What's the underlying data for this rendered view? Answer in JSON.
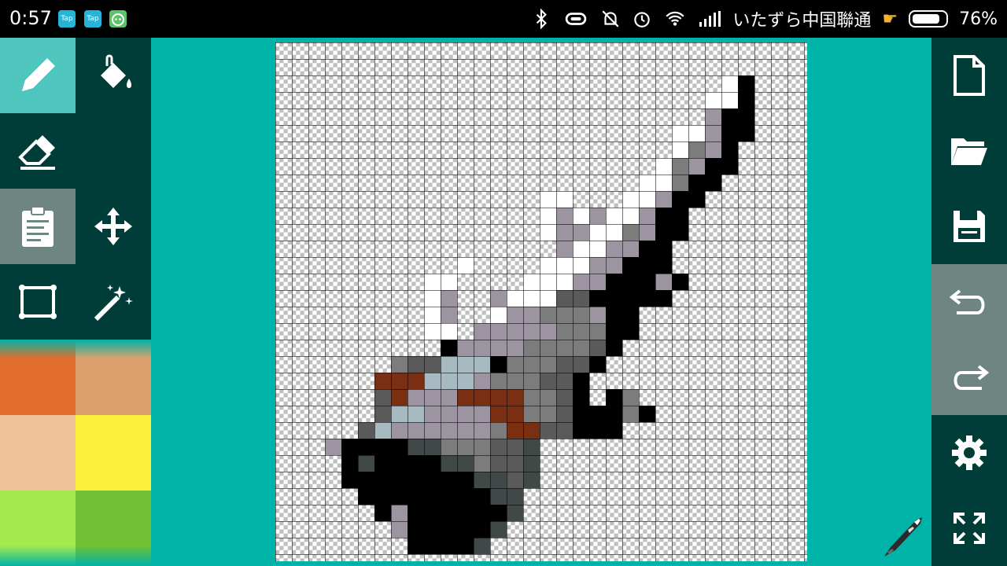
{
  "status_bar": {
    "time": "0:57",
    "app_icons": [
      {
        "name": "tap-app-icon",
        "label": "Tap",
        "color": "#28b4d6"
      },
      {
        "name": "tap-app-icon-2",
        "label": "Tap",
        "color": "#28b4d6"
      },
      {
        "name": "android-cat-icon",
        "label": "",
        "color": "#5cc36a"
      }
    ],
    "carrier": "いたずら中国聯通",
    "battery": "76%"
  },
  "tools": [
    {
      "name": "pencil-tool",
      "icon": "pencil-icon",
      "selected": true
    },
    {
      "name": "fill-tool",
      "icon": "paint-bucket-icon",
      "selected": false
    },
    {
      "name": "eraser-tool",
      "icon": "eraser-icon",
      "selected": false
    },
    {
      "name": "clipboard-tool",
      "icon": "clipboard-icon",
      "selected": true
    },
    {
      "name": "move-tool",
      "icon": "move-arrows-icon",
      "selected": false
    },
    {
      "name": "rectangle-select-tool",
      "icon": "rectangle-icon",
      "selected": false
    },
    {
      "name": "magic-wand-tool",
      "icon": "magic-wand-icon",
      "selected": false
    }
  ],
  "palette": {
    "colors": [
      "#e16f2b",
      "#dba06e",
      "#f1c19a",
      "#fdf03c",
      "#a2ea4e",
      "#6fc133"
    ],
    "accent": "#00b3a8",
    "panel": "#003d39"
  },
  "actions": [
    {
      "name": "new-file-button",
      "icon": "new-document-icon"
    },
    {
      "name": "open-folder-button",
      "icon": "folder-open-icon"
    },
    {
      "name": "save-button",
      "icon": "save-disk-icon"
    },
    {
      "name": "undo-button",
      "icon": "undo-icon"
    },
    {
      "name": "redo-button",
      "icon": "redo-icon"
    },
    {
      "name": "settings-button",
      "icon": "gear-icon"
    },
    {
      "name": "fullscreen-button",
      "icon": "expand-arrows-icon"
    }
  ],
  "canvas": {
    "grid_columns": 32,
    "grid_rows": 31,
    "sprite_palette": {
      "W": "#ffffff",
      "L": "#9c94a1",
      "M": "#7c7c7c",
      "D": "#5a5a5a",
      "E": "#404848",
      "K": "#000000",
      "B": "#a7b9c1",
      "R": "#7a2e12"
    }
  }
}
